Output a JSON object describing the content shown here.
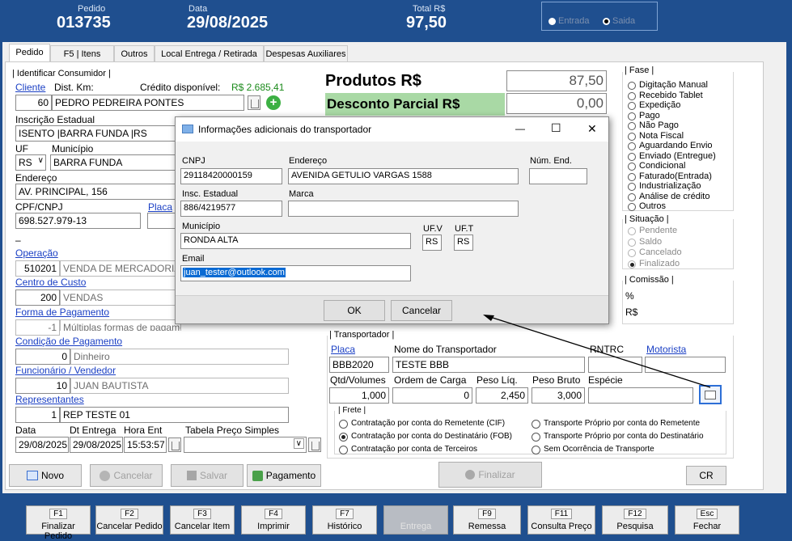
{
  "header": {
    "pedido_label": "Pedido",
    "pedido": "013735",
    "data_label": "Data",
    "data": "29/08/2025",
    "total_label": "Total R$",
    "total": "97,50",
    "entrada": "Entrada",
    "saida": "Saida"
  },
  "tabs": [
    "Pedido",
    "F5 | Itens",
    "Outros",
    "Local Entrega / Retirada",
    "Despesas Auxiliares"
  ],
  "consumidor": {
    "group": "| Identificar Consumidor |",
    "cliente_link": "Cliente",
    "dist_label": "Dist. Km:",
    "credito_label": "Crédito disponível:",
    "credito": "R$ 2.685,41",
    "cliente_cod": "60",
    "cliente_nome": "PEDRO PEDREIRA PONTES",
    "ie_label": "Inscrição Estadual",
    "ie": "ISENTO |BARRA FUNDA |RS",
    "uf_label": "UF",
    "municipio_label": "Município",
    "uf": "RS",
    "municipio": "BARRA FUNDA",
    "endereco_label": "Endereço",
    "endereco": "AV. PRINCIPAL, 156",
    "cpf_label": "CPF/CNPJ",
    "placa_link": "Placa",
    "cpf": "698.527.979-13",
    "dash": "–"
  },
  "pedido": {
    "operacao_link": "Operação",
    "operacao_cod": "510201",
    "operacao": "VENDA DE MERCADORIA",
    "custo_link": "Centro de Custo",
    "custo_cod": "200",
    "custo": "VENDAS",
    "forma_link": "Forma de Pagamento",
    "forma_cod": "-1",
    "forma": "Múltiplas formas de pagamento",
    "cond_link": "Condição de Pagamento",
    "cond_cod": "0",
    "cond": "Dinheiro",
    "func_link": "Funcionário / Vendedor",
    "func_cod": "10",
    "func": "JUAN BAUTISTA",
    "rep_link": "Representantes",
    "rep_cod": "1",
    "rep": "REP TESTE 01",
    "data_label": "Data",
    "dtent_label": "Dt Entrega",
    "horaent_label": "Hora Ent",
    "tabela_label": "Tabela Preço Simples",
    "data": "29/08/2025",
    "dtent": "29/08/2025",
    "hora": "15:53:57"
  },
  "totais": {
    "produtos_label": "Produtos R$",
    "produtos": "87,50",
    "desconto_label": "Desconto Parcial R$",
    "desconto": "0,00"
  },
  "fase": {
    "title": "| Fase |",
    "options": [
      "Digitação Manual",
      "Recebido Tablet",
      "Expedição",
      "Pago",
      "Não Pago",
      "Nota Fiscal",
      "Aguardando Envio",
      "Enviado (Entregue)",
      "Condicional",
      "Faturado(Entrada)",
      "Industrialização",
      "Análise de crédito",
      "Outros"
    ]
  },
  "situacao": {
    "title": "| Situação |",
    "options": [
      "Pendente",
      "Saldo",
      "Cancelado",
      "Finalizado"
    ],
    "selected": "Finalizado"
  },
  "comissao": {
    "title": "| Comissão |",
    "pct": "%",
    "rs": "R$"
  },
  "transportador": {
    "title": "| Transportador |",
    "placa_link": "Placa",
    "nome_label": "Nome do Transportador",
    "rntrc_label": "RNTRC",
    "motorista_link": "Motorista",
    "placa": "BBB2020",
    "nome": "TESTE BBB",
    "qtd_label": "Qtd/Volumes",
    "ordem_label": "Ordem de Carga",
    "pliq_label": "Peso Líq.",
    "pbruto_label": "Peso Bruto",
    "especie_label": "Espécie",
    "qtd": "1,000",
    "ordem": "0",
    "pliq": "2,450",
    "pbruto": "3,000"
  },
  "frete": {
    "title": "| Frete |",
    "options": [
      "Contratação por conta do Remetente (CIF)",
      "Contratação por conta do Destinatário (FOB)",
      "Contratação por conta de Terceiros",
      "Transporte Próprio por conta do Remetente",
      "Transporte Próprio por conta do Destinatário",
      "Sem Ocorrência de Transporte"
    ],
    "selected": "Contratação por conta do Destinatário (FOB)"
  },
  "buttons": {
    "novo": "Novo",
    "cancelar": "Cancelar",
    "salvar": "Salvar",
    "pagamento": "Pagamento",
    "finalizar": "Finalizar",
    "cr": "CR"
  },
  "bottom": [
    {
      "key": "F1",
      "label": "Finalizar Pedido"
    },
    {
      "key": "F2",
      "label": "Cancelar Pedido"
    },
    {
      "key": "F3",
      "label": "Cancelar Item"
    },
    {
      "key": "F4",
      "label": "Imprimir"
    },
    {
      "key": "F7",
      "label": "Histórico"
    },
    {
      "key": "",
      "label": "Entrega"
    },
    {
      "key": "F9",
      "label": "Remessa"
    },
    {
      "key": "F11",
      "label": "Consulta Preço"
    },
    {
      "key": "F12",
      "label": "Pesquisa"
    },
    {
      "key": "Esc",
      "label": "Fechar"
    }
  ],
  "dialog": {
    "title": "Informações adicionais do transportador",
    "cnpj_label": "CNPJ",
    "cnpj": "29118420000159",
    "endereco_label": "Endereço",
    "endereco": "AVENIDA GETULIO VARGAS 1588",
    "numend_label": "Núm. End.",
    "ie_label": "Insc. Estadual",
    "ie": "886/4219577",
    "marca_label": "Marca",
    "municipio_label": "Município",
    "municipio": "RONDA ALTA",
    "ufv_label": "UF.V",
    "ufv": "RS",
    "uft_label": "UF.T",
    "uft": "RS",
    "email_label": "Email",
    "email": "juan_tester@outlook.com",
    "ok": "OK",
    "cancelar": "Cancelar",
    "min": "—",
    "max": "☐",
    "close": "✕"
  },
  "colors": {
    "header_bg": "#1f4f8f",
    "desconto_bg": "#a9d9a5",
    "selection": "#0a6ad3"
  }
}
